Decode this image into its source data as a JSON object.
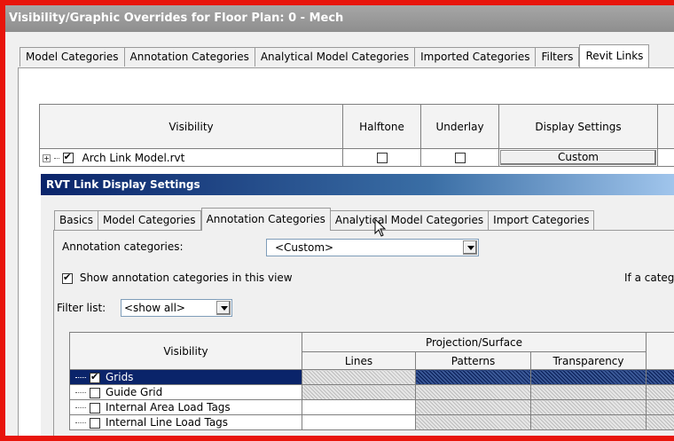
{
  "window": {
    "title": "Visibility/Graphic Overrides for Floor Plan: 0 - Mech"
  },
  "outer_tabs": [
    {
      "label": "Model Categories",
      "active": false
    },
    {
      "label": "Annotation Categories",
      "active": false
    },
    {
      "label": "Analytical Model Categories",
      "active": false
    },
    {
      "label": "Imported Categories",
      "active": false
    },
    {
      "label": "Filters",
      "active": false
    },
    {
      "label": "Revit Links",
      "active": true
    }
  ],
  "links_table": {
    "headers": {
      "visibility": "Visibility",
      "halftone": "Halftone",
      "underlay": "Underlay",
      "display": "Display Settings"
    },
    "rows": [
      {
        "expander": "+",
        "checked": true,
        "name": "Arch Link Model.rvt",
        "halftone": false,
        "underlay": false,
        "display": "Custom"
      }
    ]
  },
  "dialog": {
    "title": "RVT Link Display Settings",
    "tabs": [
      {
        "label": "Basics",
        "active": false
      },
      {
        "label": "Model Categories",
        "active": false
      },
      {
        "label": "Annotation Categories",
        "active": true
      },
      {
        "label": "Analytical Model Categories",
        "active": false
      },
      {
        "label": "Import Categories",
        "active": false
      }
    ],
    "annotation_label": "Annotation categories:",
    "annotation_value": "<Custom>",
    "show_annotation_label": "Show annotation categories in this view",
    "show_annotation_checked": true,
    "note_text": "If a categ",
    "filter_label": "Filter list:",
    "filter_value": "<show all>",
    "grid": {
      "header_visibility": "Visibility",
      "header_group": "Projection/Surface",
      "header_lines": "Lines",
      "header_patterns": "Patterns",
      "header_transparency": "Transparency",
      "rows": [
        {
          "name": "Grids",
          "checked": true,
          "selected": true
        },
        {
          "name": "Guide Grid",
          "checked": false,
          "selected": false
        },
        {
          "name": "Internal Area Load Tags",
          "checked": false,
          "selected": false
        },
        {
          "name": "Internal Line Load Tags",
          "checked": false,
          "selected": false
        }
      ]
    }
  }
}
